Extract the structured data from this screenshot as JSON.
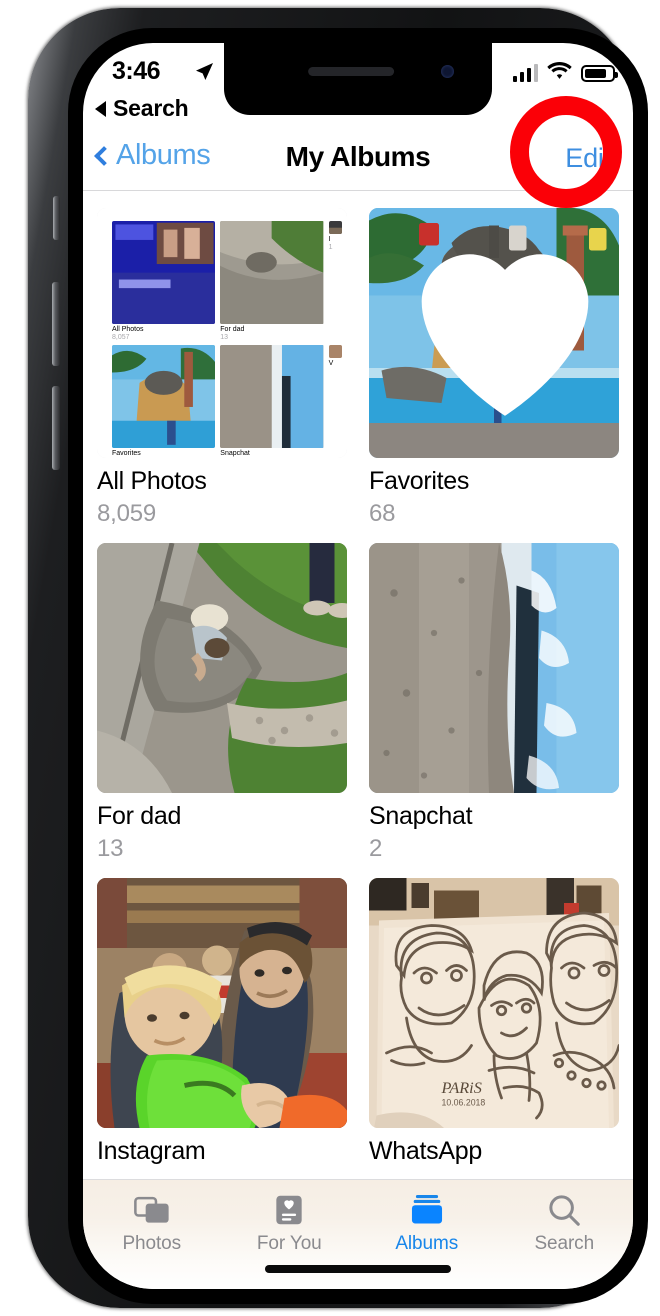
{
  "status_bar": {
    "time": "3:46",
    "location_icon": "location-arrow-icon",
    "cellular_icon": "cellular-signal-icon",
    "wifi_icon": "wifi-icon",
    "battery_icon": "battery-icon"
  },
  "back_to_app": {
    "label": "Search",
    "icon": "back-triangle-icon"
  },
  "nav_bar": {
    "back_label": "Albums",
    "back_icon": "chevron-left-icon",
    "title": "My Albums",
    "edit_label": "Edit"
  },
  "annotation": {
    "type": "red-pill-outline",
    "target": "Edit",
    "color": "#fb0007"
  },
  "albums": [
    {
      "title": "All Photos",
      "count": "8,059",
      "thumb": "nested-albums-screenshot",
      "favorite_badge": false
    },
    {
      "title": "Favorites",
      "count": "68",
      "thumb": "fountain-statue-photo",
      "favorite_badge": true,
      "badge_icon": "heart-icon"
    },
    {
      "title": "For dad",
      "count": "13",
      "thumb": "child-in-mud-puddle-photo",
      "favorite_badge": false
    },
    {
      "title": "Snapchat",
      "count": "2",
      "thumb": "beach-sideways-photo",
      "favorite_badge": false
    },
    {
      "title": "Instagram",
      "count": "",
      "thumb": "man-holding-child-photo",
      "favorite_badge": false
    },
    {
      "title": "WhatsApp",
      "count": "",
      "thumb": "caricature-drawing-photo",
      "favorite_badge": false
    }
  ],
  "nested_screenshot": {
    "albums": [
      {
        "title": "All Photos",
        "count": "8,057"
      },
      {
        "title": "For dad",
        "count": "13"
      },
      {
        "title": "Favorites",
        "count": ""
      },
      {
        "title": "Snapchat",
        "count": ""
      }
    ]
  },
  "tab_bar": {
    "active": "Albums",
    "accent_color": "#1886ea",
    "items": [
      {
        "label": "Photos",
        "icon": "photos-stack-icon"
      },
      {
        "label": "For You",
        "icon": "for-you-card-icon"
      },
      {
        "label": "Albums",
        "icon": "albums-folder-icon"
      },
      {
        "label": "Search",
        "icon": "search-magnifier-icon"
      }
    ]
  }
}
